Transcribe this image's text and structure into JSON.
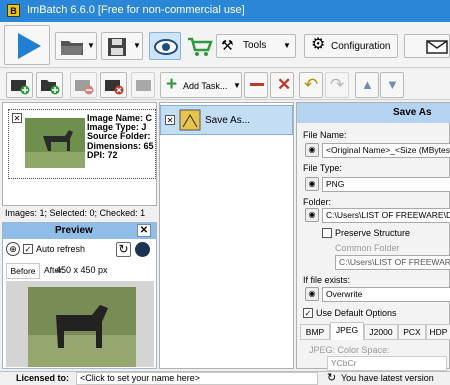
{
  "window": {
    "title": "ImBatch 6.6.0 [Free for non-commercial use]",
    "logo": "B"
  },
  "toolbar": {
    "tools_label": "Tools",
    "configuration_label": "Configuration"
  },
  "toolbar2": {
    "add_task_label": "Add Task..."
  },
  "image_info": {
    "labels": [
      "Image Name:",
      "Image Type:",
      "Source Folder:",
      "Dimensions:",
      "DPI:"
    ],
    "values": [
      "C",
      "J",
      "",
      "65",
      "72"
    ]
  },
  "image_counts": "Images: 1; Selected: 0; Checked: 1",
  "preview": {
    "title": "Preview",
    "auto_refresh": "Auto refresh",
    "before": "Before",
    "after_size": "After:",
    "size": "450 x 450 px"
  },
  "tasks": [
    {
      "label": "Save As..."
    }
  ],
  "save_as": {
    "title": "Save As",
    "file_name_label": "File Name:",
    "file_name_value": "<Original Name>_<Size (MBytes)>",
    "file_type_label": "File Type:",
    "file_type_value": "PNG",
    "folder_label": "Folder:",
    "folder_value": "C:\\Users\\LIST OF FREEWARE\\Dow",
    "preserve_structure": "Preserve Structure",
    "common_folder_label": "Common Folder",
    "common_folder_value": "C:\\Users\\LIST OF FREEWARE\\D",
    "if_exists_label": "If file exists:",
    "if_exists_value": "Overwrite",
    "use_default_options": "Use Default Options",
    "format_tabs": [
      "BMP",
      "JPEG",
      "J2000",
      "PCX",
      "HDP"
    ],
    "jpeg_color_space_label": "JPEG: Color Space:",
    "jpeg_color_space_value": "YCbCr"
  },
  "status": {
    "licensed_label": "Licensed to:",
    "licensed_value": "<Click to set your name here>",
    "version_message": "You have latest version"
  },
  "colors": {
    "accent": "#2a86d6",
    "save_as_header": "#b3d3f1"
  }
}
